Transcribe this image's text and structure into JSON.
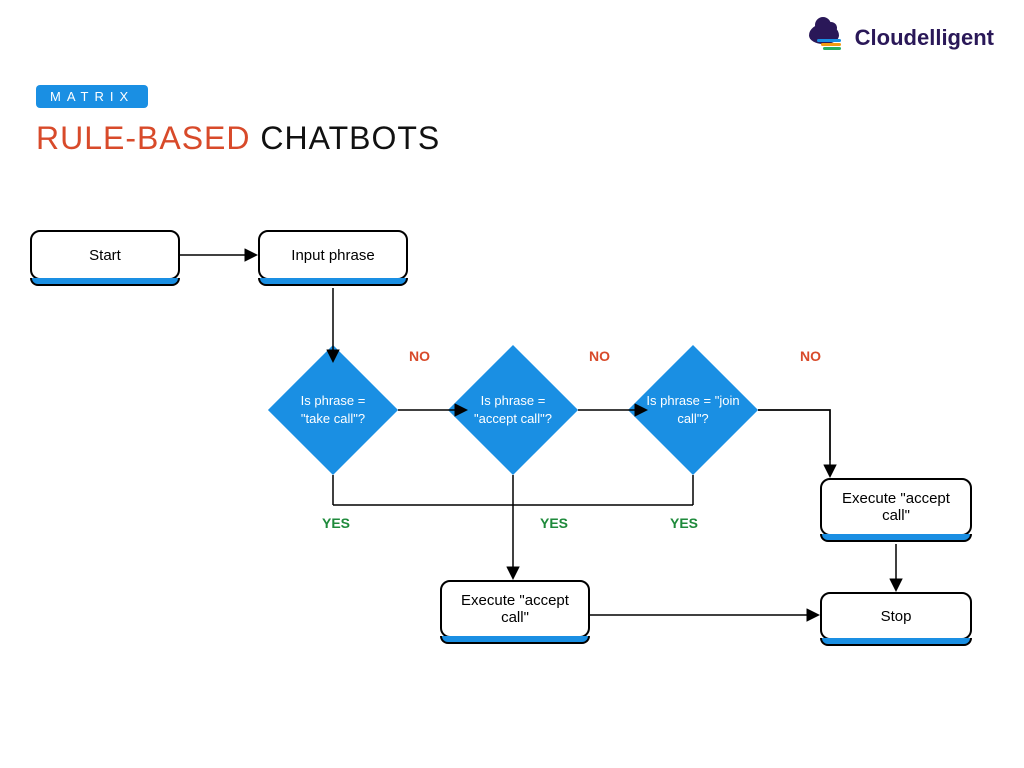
{
  "badge": "MATRIX",
  "title_rule": "RULE-BASED",
  "title_chat": " CHATBOTS",
  "logo_text": "Cloudelligent",
  "nodes": {
    "start": "Start",
    "input": "Input phrase",
    "d1": "Is phrase = \"take call\"?",
    "d2": "Is phrase = \"accept call\"?",
    "d3": "Is phrase = \"join call\"?",
    "exec1": "Execute \"accept call\"",
    "exec2": "Execute \"accept call\"",
    "stop": "Stop"
  },
  "labels": {
    "no": "NO",
    "yes": "YES"
  }
}
